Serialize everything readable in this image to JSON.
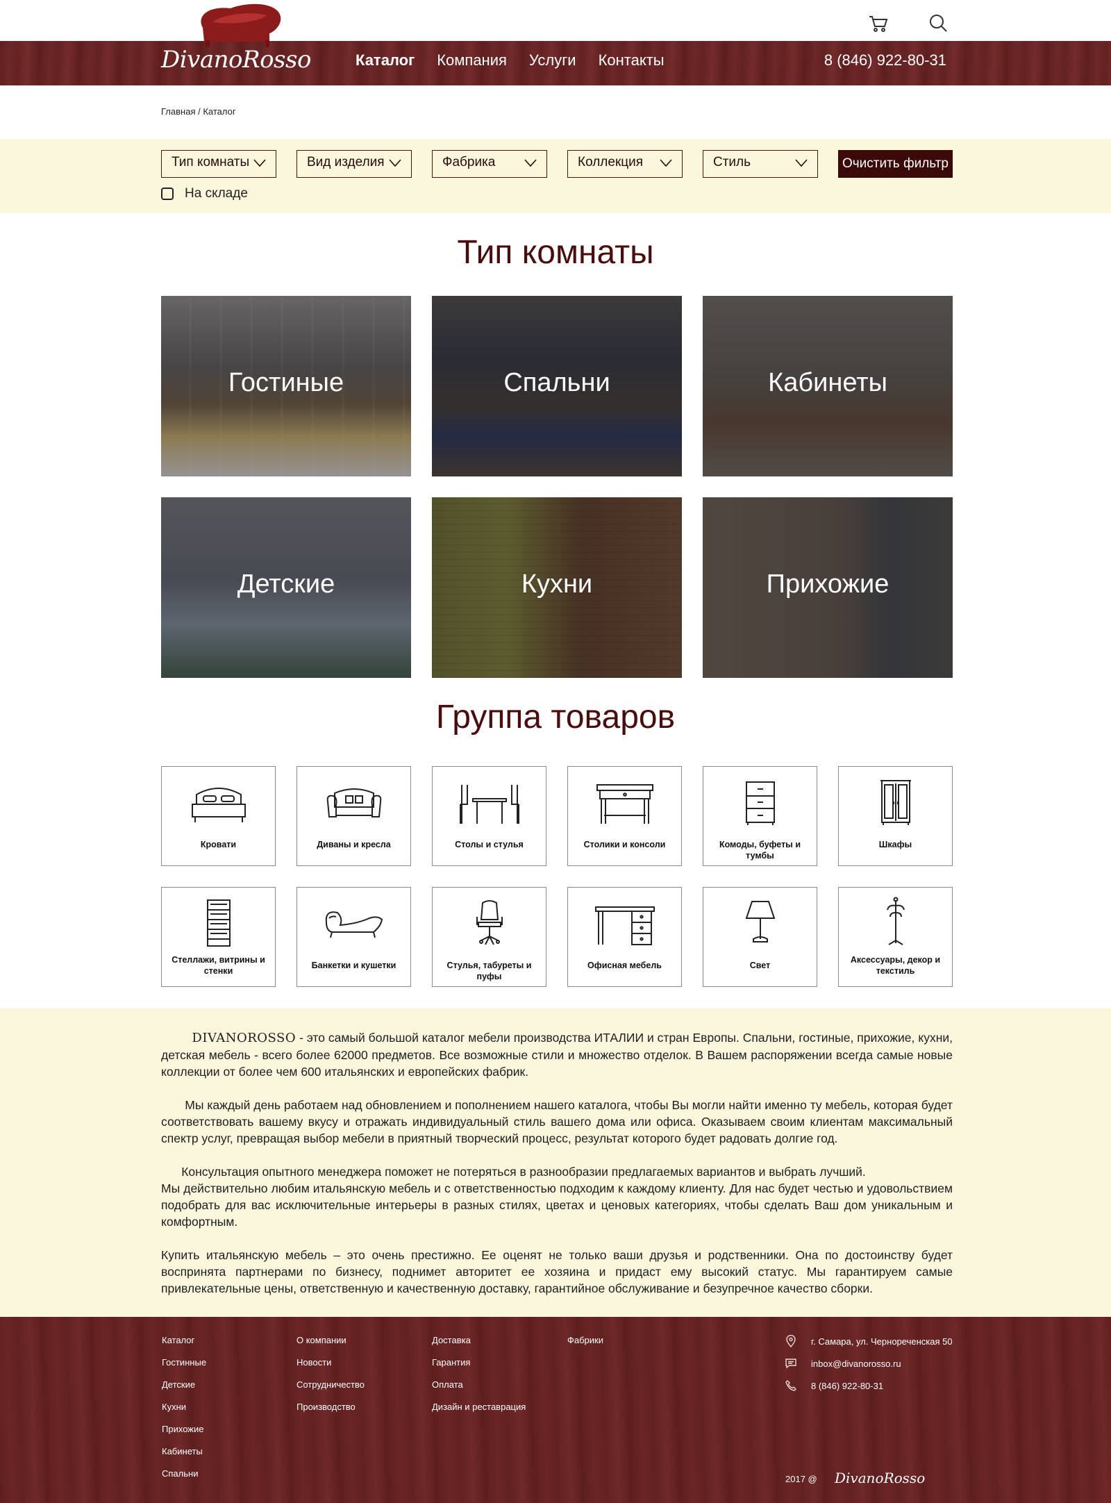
{
  "header": {
    "logo_text": "DivanoRosso",
    "nav": [
      {
        "label": "Каталог",
        "active": true
      },
      {
        "label": "Компания",
        "active": false
      },
      {
        "label": "Услуги",
        "active": false
      },
      {
        "label": "Контакты",
        "active": false
      }
    ],
    "phone": "8 (846) 922-80-31",
    "icons": [
      "cart-icon",
      "search-icon"
    ]
  },
  "breadcrumb": "Главная / Каталог",
  "filters": {
    "selects": [
      "Тип комнаты",
      "Вид изделия",
      "Фабрика",
      "Коллекция",
      "Стиль"
    ],
    "clear_label": "Очистить фильтр",
    "in_stock_label": "На складе",
    "in_stock_checked": false
  },
  "rooms": {
    "title": "Тип комнаты",
    "items": [
      "Гостиные",
      "Спальни",
      "Кабинеты",
      "Детские",
      "Кухни",
      "Прихожие"
    ]
  },
  "groups": {
    "title": "Группа товаров",
    "items": [
      {
        "label": "Кровати",
        "icon": "bed-icon"
      },
      {
        "label": "Диваны и кресла",
        "icon": "sofa-icon"
      },
      {
        "label": "Столы и стулья",
        "icon": "table-chairs-icon"
      },
      {
        "label": "Столики и консоли",
        "icon": "console-table-icon"
      },
      {
        "label": "Комоды, буфеты и тумбы",
        "icon": "chest-of-drawers-icon"
      },
      {
        "label": "Шкафы",
        "icon": "wardrobe-icon"
      },
      {
        "label": "Стеллажи, витрины и стенки",
        "icon": "shelving-icon"
      },
      {
        "label": "Банкетки и кушетки",
        "icon": "couch-icon"
      },
      {
        "label": "Стулья, табуреты и пуфы",
        "icon": "office-chair-icon"
      },
      {
        "label": "Офисная мебель",
        "icon": "desk-icon"
      },
      {
        "label": "Свет",
        "icon": "lamp-icon"
      },
      {
        "label": "Аксессуары, декор и текстиль",
        "icon": "coat-rack-icon"
      }
    ]
  },
  "about": {
    "brand": "DIVANOROSSO",
    "p1": " - это самый большой каталог мебели производства ИТАЛИИ и стран Европы.  Спальни, гостиные, прихожие, кухни, детская мебель - всего более 62000 предметов.  Все возможные стили и  множество отделок.  В Вашем распоряжении всегда самые новые коллекции от более чем 600 итальянских и европейских фабрик.",
    "p2": "Мы каждый день работаем над обновлением и пополнением нашего каталога, чтобы Вы могли найти именно ту мебель, которая будет соответствовать вашему вкусу и отражать индивидуальный стиль вашего дома или офиса. Оказываем своим клиентам максимальный спектр услуг,  превращая выбор мебели в приятный творческий процесс, результат которого будет радовать долгие год.",
    "p3a": "Консультация опытного менеджера  поможет не потеряться в разнообразии предлагаемых вариантов и выбрать лучший.",
    "p3b": "Мы действительно любим итальянскую мебель и с ответственностью подходим к каждому клиенту. Для нас будет честью и удовольствием подобрать для вас исключительные интерьеры в разных стилях, цветах и ценовых категориях, чтобы сделать Ваш дом уникальным и комфортным.",
    "p4": "Купить итальянскую мебель – это очень престижно. Ее оценят не только ваши друзья и родственники. Она по достоинству будет воспринята партнерами по бизнесу, поднимет авторитет ее хозяина и придаст ему высокий статус. Мы гарантируем   самые привлекательные цены, ответственную и качественную доставку, гарантийное обслуживание и безупречное качество сборки."
  },
  "footer": {
    "col1": [
      "Каталог",
      "Гостинные",
      "Детские",
      "Кухни",
      "Прихожие",
      "Кабинеты",
      "Спальни"
    ],
    "col2": [
      "О компании",
      "Новости",
      "Сотрудничество",
      "Производство"
    ],
    "col3": [
      "Доставка",
      "Гарантия",
      "Оплата",
      "Дизайн и реставрация"
    ],
    "col4": [
      "Фабрики"
    ],
    "address": "г. Самара, ул. Чернореченская 50",
    "email": "inbox@divanorosso.ru",
    "phone": "8 (846) 922-80-31",
    "copyright": "2017 @",
    "logo_text": "DivanoRosso"
  },
  "colors": {
    "brand_dark": "#4a0c0c",
    "wood": "#6b2525",
    "cream": "#fbf7dc",
    "button": "#3c0909"
  }
}
